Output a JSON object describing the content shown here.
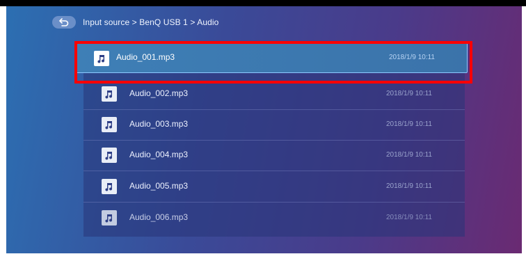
{
  "breadcrumb": {
    "text": "Input source > BenQ USB 1 > Audio",
    "back_icon": "return-arrow-icon"
  },
  "files": [
    {
      "name": "Audio_001.mp3",
      "date": "2018/1/9 10:11",
      "selected": true
    },
    {
      "name": "Audio_002.mp3",
      "date": "2018/1/9 10:11"
    },
    {
      "name": "Audio_003.mp3",
      "date": "2018/1/9 10:11"
    },
    {
      "name": "Audio_004.mp3",
      "date": "2018/1/9 10:11"
    },
    {
      "name": "Audio_005.mp3",
      "date": "2018/1/9 10:11"
    },
    {
      "name": "Audio_006.mp3",
      "date": "2018/1/9 10:11"
    }
  ],
  "colors": {
    "highlight": "#ff0000",
    "selected_row": "#3e7fb6",
    "list_bg": "#28347a"
  },
  "file_icon": "music-note-icon"
}
